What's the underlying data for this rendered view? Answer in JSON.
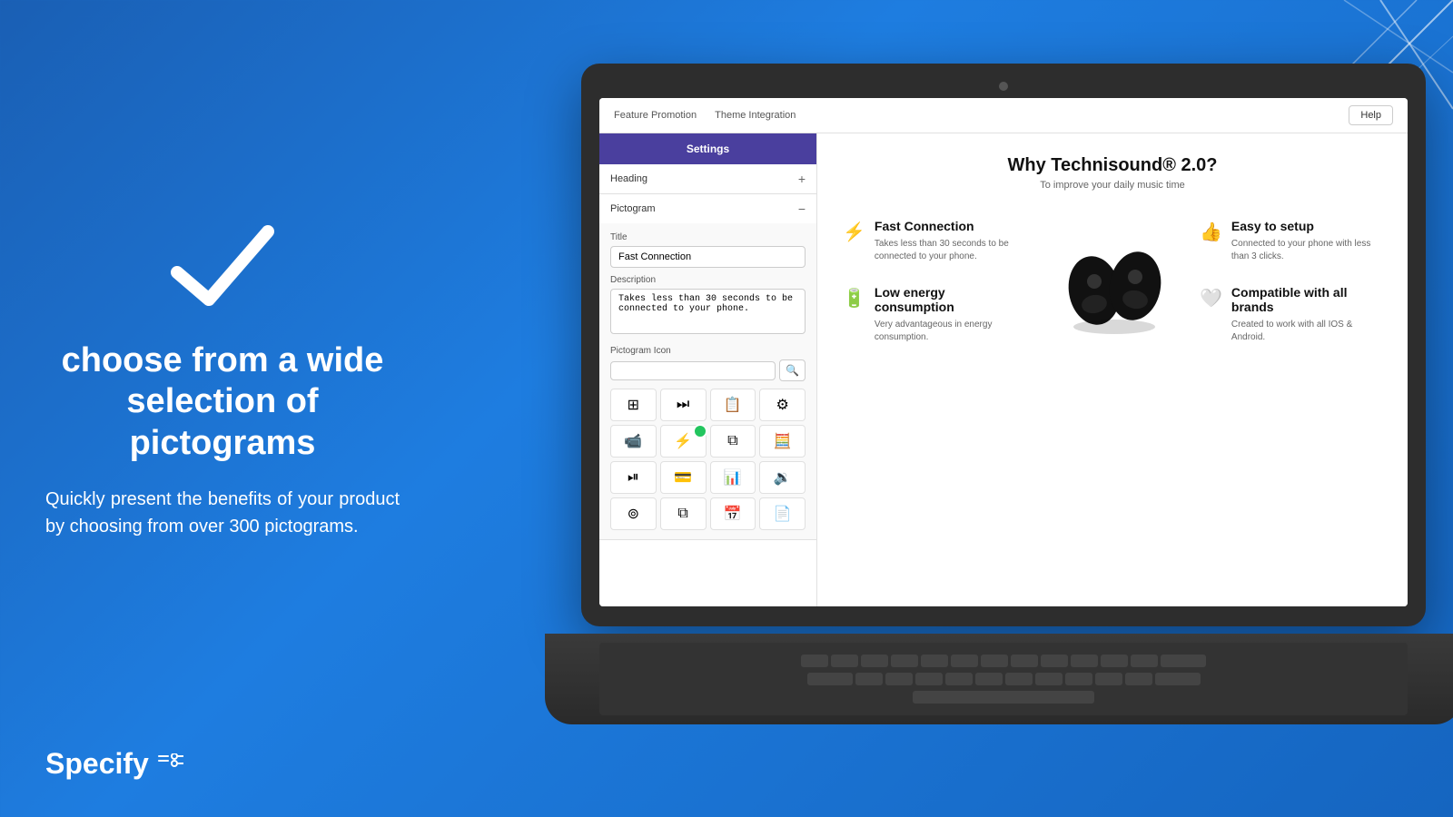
{
  "background": {
    "gradient_start": "#1a5fb4",
    "gradient_end": "#1565c0"
  },
  "left_panel": {
    "checkmark": "✓",
    "main_heading": "choose from a wide selection of pictograms",
    "sub_text": "Quickly present the benefits of your product by choosing from over 300 pictograms.",
    "logo_text": "Specify"
  },
  "app": {
    "nav_items": [
      "Feature Promotion",
      "Theme Integration"
    ],
    "help_button": "Help",
    "sidebar": {
      "settings_button": "Settings",
      "heading_section": {
        "label": "Heading",
        "icon": "+"
      },
      "pictogram_section": {
        "label": "Pictogram",
        "icon": "−",
        "title_label": "Title",
        "title_value": "Fast Connection",
        "description_label": "Description",
        "description_value": "Takes less than 30 seconds to be connected to your phone.",
        "icon_label": "Pictogram Icon",
        "icons": [
          "⊞",
          "⏭",
          "📋",
          "⚙",
          "📹",
          "⚡",
          "⧉",
          "🧮",
          "⊙",
          "💳",
          "📊",
          "🔉",
          "⊚",
          "⧉",
          "📅",
          "📄"
        ]
      }
    },
    "content": {
      "product_name": "Why Technisound® 2.0?",
      "product_subtitle": "To improve your daily music time",
      "features": [
        {
          "icon": "⚡",
          "title": "Fast Connection",
          "description": "Takes less than 30 seconds to be connected to your phone."
        },
        {
          "icon": "🔋",
          "title": "Low energy consumption",
          "description": "Very advantageous in energy consumption."
        },
        {
          "icon": "👍",
          "title": "Easy to setup",
          "description": "Connected to your phone with less than 3 clicks."
        },
        {
          "icon": "🤍",
          "title": "Compatible with all brands",
          "description": "Created to work with all IOS & Android."
        }
      ]
    }
  }
}
